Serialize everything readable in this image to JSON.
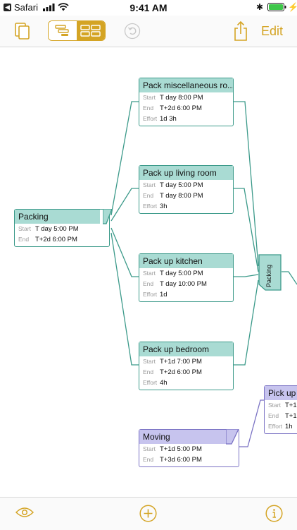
{
  "status_bar": {
    "back_app": "Safari",
    "time": "9:41 AM"
  },
  "toolbar": {
    "edit_label": "Edit"
  },
  "colors": {
    "accent": "#d4a424",
    "green_border": "#3c9a8a",
    "green_header": "#a9dbd3",
    "purple_border": "#7a72c4",
    "purple_header": "#c7c4ee"
  },
  "labels": {
    "start": "Start",
    "end": "End",
    "effort": "Effort"
  },
  "group_milestone": {
    "label": "Packing"
  },
  "tasks": [
    {
      "title": "Packing",
      "start": "T day 5:00 PM",
      "end": "T+2d 6:00 PM"
    },
    {
      "title": "Pack miscellaneous ro...",
      "start": "T day 8:00 PM",
      "end": "T+2d 6:00 PM",
      "effort": "1d 3h"
    },
    {
      "title": "Pack up living room",
      "start": "T day 5:00 PM",
      "end": "T day 8:00 PM",
      "effort": "3h"
    },
    {
      "title": "Pack up kitchen",
      "start": "T day 5:00 PM",
      "end": "T day 10:00 PM",
      "effort": "1d"
    },
    {
      "title": "Pack up bedroom",
      "start": "T+1d 7:00 PM",
      "end": "T+2d 6:00 PM",
      "effort": "4h"
    },
    {
      "title": "Moving",
      "start": "T+1d 5:00 PM",
      "end": "T+3d 6:00 PM"
    },
    {
      "title": "Pick up r",
      "start": "T+1",
      "end": "T+1",
      "effort": "1h"
    }
  ]
}
